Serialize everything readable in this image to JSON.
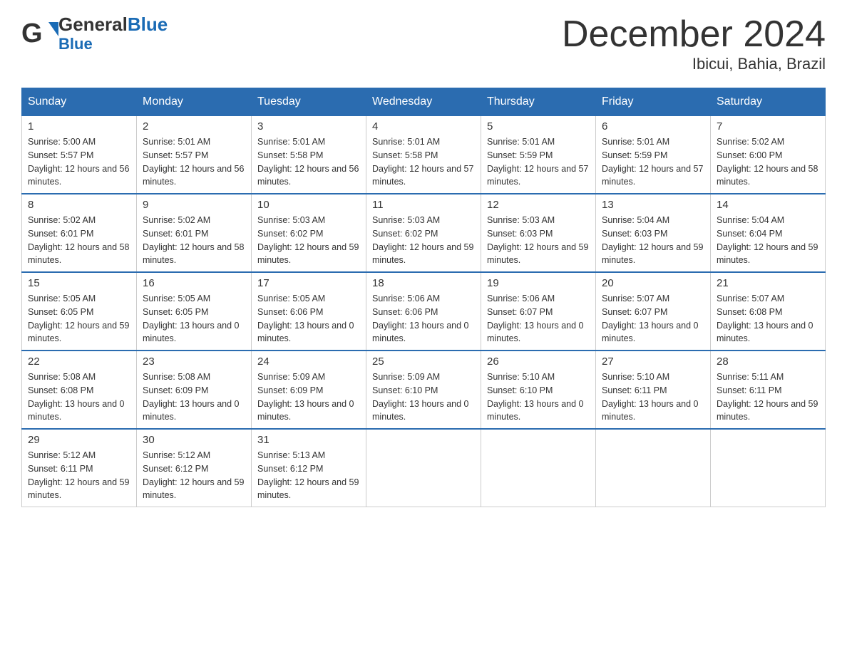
{
  "header": {
    "logo_general": "General",
    "logo_blue": "Blue",
    "title": "December 2024",
    "location": "Ibicui, Bahia, Brazil"
  },
  "days_of_week": [
    "Sunday",
    "Monday",
    "Tuesday",
    "Wednesday",
    "Thursday",
    "Friday",
    "Saturday"
  ],
  "weeks": [
    [
      {
        "day": "1",
        "sunrise": "5:00 AM",
        "sunset": "5:57 PM",
        "daylight": "12 hours and 56 minutes."
      },
      {
        "day": "2",
        "sunrise": "5:01 AM",
        "sunset": "5:57 PM",
        "daylight": "12 hours and 56 minutes."
      },
      {
        "day": "3",
        "sunrise": "5:01 AM",
        "sunset": "5:58 PM",
        "daylight": "12 hours and 56 minutes."
      },
      {
        "day": "4",
        "sunrise": "5:01 AM",
        "sunset": "5:58 PM",
        "daylight": "12 hours and 57 minutes."
      },
      {
        "day": "5",
        "sunrise": "5:01 AM",
        "sunset": "5:59 PM",
        "daylight": "12 hours and 57 minutes."
      },
      {
        "day": "6",
        "sunrise": "5:01 AM",
        "sunset": "5:59 PM",
        "daylight": "12 hours and 57 minutes."
      },
      {
        "day": "7",
        "sunrise": "5:02 AM",
        "sunset": "6:00 PM",
        "daylight": "12 hours and 58 minutes."
      }
    ],
    [
      {
        "day": "8",
        "sunrise": "5:02 AM",
        "sunset": "6:01 PM",
        "daylight": "12 hours and 58 minutes."
      },
      {
        "day": "9",
        "sunrise": "5:02 AM",
        "sunset": "6:01 PM",
        "daylight": "12 hours and 58 minutes."
      },
      {
        "day": "10",
        "sunrise": "5:03 AM",
        "sunset": "6:02 PM",
        "daylight": "12 hours and 59 minutes."
      },
      {
        "day": "11",
        "sunrise": "5:03 AM",
        "sunset": "6:02 PM",
        "daylight": "12 hours and 59 minutes."
      },
      {
        "day": "12",
        "sunrise": "5:03 AM",
        "sunset": "6:03 PM",
        "daylight": "12 hours and 59 minutes."
      },
      {
        "day": "13",
        "sunrise": "5:04 AM",
        "sunset": "6:03 PM",
        "daylight": "12 hours and 59 minutes."
      },
      {
        "day": "14",
        "sunrise": "5:04 AM",
        "sunset": "6:04 PM",
        "daylight": "12 hours and 59 minutes."
      }
    ],
    [
      {
        "day": "15",
        "sunrise": "5:05 AM",
        "sunset": "6:05 PM",
        "daylight": "12 hours and 59 minutes."
      },
      {
        "day": "16",
        "sunrise": "5:05 AM",
        "sunset": "6:05 PM",
        "daylight": "13 hours and 0 minutes."
      },
      {
        "day": "17",
        "sunrise": "5:05 AM",
        "sunset": "6:06 PM",
        "daylight": "13 hours and 0 minutes."
      },
      {
        "day": "18",
        "sunrise": "5:06 AM",
        "sunset": "6:06 PM",
        "daylight": "13 hours and 0 minutes."
      },
      {
        "day": "19",
        "sunrise": "5:06 AM",
        "sunset": "6:07 PM",
        "daylight": "13 hours and 0 minutes."
      },
      {
        "day": "20",
        "sunrise": "5:07 AM",
        "sunset": "6:07 PM",
        "daylight": "13 hours and 0 minutes."
      },
      {
        "day": "21",
        "sunrise": "5:07 AM",
        "sunset": "6:08 PM",
        "daylight": "13 hours and 0 minutes."
      }
    ],
    [
      {
        "day": "22",
        "sunrise": "5:08 AM",
        "sunset": "6:08 PM",
        "daylight": "13 hours and 0 minutes."
      },
      {
        "day": "23",
        "sunrise": "5:08 AM",
        "sunset": "6:09 PM",
        "daylight": "13 hours and 0 minutes."
      },
      {
        "day": "24",
        "sunrise": "5:09 AM",
        "sunset": "6:09 PM",
        "daylight": "13 hours and 0 minutes."
      },
      {
        "day": "25",
        "sunrise": "5:09 AM",
        "sunset": "6:10 PM",
        "daylight": "13 hours and 0 minutes."
      },
      {
        "day": "26",
        "sunrise": "5:10 AM",
        "sunset": "6:10 PM",
        "daylight": "13 hours and 0 minutes."
      },
      {
        "day": "27",
        "sunrise": "5:10 AM",
        "sunset": "6:11 PM",
        "daylight": "13 hours and 0 minutes."
      },
      {
        "day": "28",
        "sunrise": "5:11 AM",
        "sunset": "6:11 PM",
        "daylight": "12 hours and 59 minutes."
      }
    ],
    [
      {
        "day": "29",
        "sunrise": "5:12 AM",
        "sunset": "6:11 PM",
        "daylight": "12 hours and 59 minutes."
      },
      {
        "day": "30",
        "sunrise": "5:12 AM",
        "sunset": "6:12 PM",
        "daylight": "12 hours and 59 minutes."
      },
      {
        "day": "31",
        "sunrise": "5:13 AM",
        "sunset": "6:12 PM",
        "daylight": "12 hours and 59 minutes."
      },
      null,
      null,
      null,
      null
    ]
  ],
  "labels": {
    "sunrise": "Sunrise:",
    "sunset": "Sunset:",
    "daylight": "Daylight:"
  }
}
